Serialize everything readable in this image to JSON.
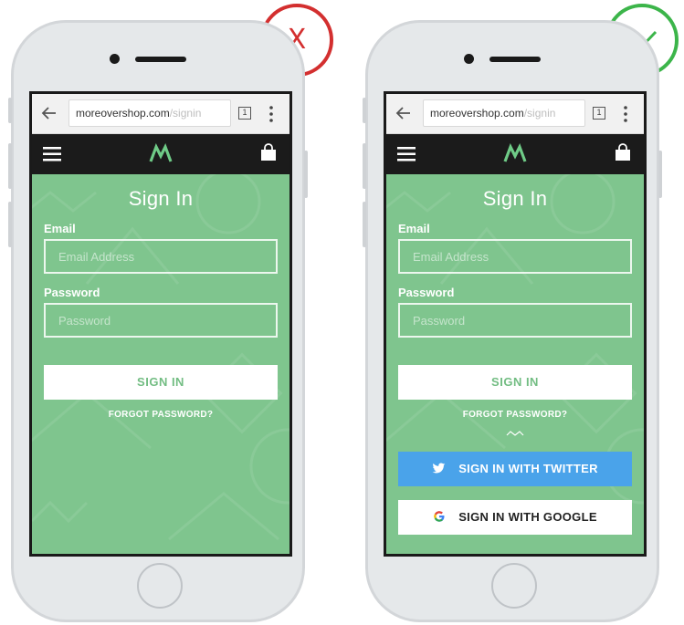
{
  "bad_mark": {
    "symbol": "X",
    "color": "#d32f2f"
  },
  "good_mark": {
    "symbol": "check",
    "color": "#3cb54a"
  },
  "browser": {
    "url_host": "moreovershop.com",
    "url_path": "/signin",
    "tab_count": "1"
  },
  "page": {
    "title": "Sign In",
    "email_label": "Email",
    "email_placeholder": "Email Address",
    "password_label": "Password",
    "password_placeholder": "Password",
    "signin_button": "SIGN IN",
    "forgot_password": "FORGOT PASSWORD?",
    "twitter_button": "SIGN IN WITH TWITTER",
    "google_button": "SIGN IN WITH GOOGLE"
  },
  "colors": {
    "brand_green": "#7fc58e",
    "logo_green": "#6fcb87",
    "header_black": "#1b1b1b",
    "twitter_blue": "#4aa3ea"
  }
}
